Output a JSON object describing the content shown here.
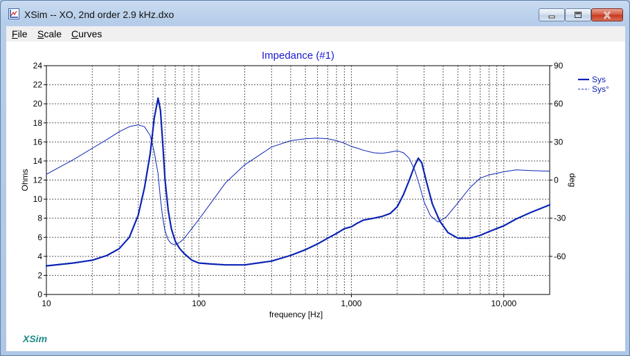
{
  "window": {
    "title": "XSim -- XO, 2nd order 2.9 kHz.dxo",
    "controls": {
      "minimize": "minimize",
      "maximize": "maximize",
      "close": "close"
    }
  },
  "menu": {
    "items": [
      "File",
      "Scale",
      "Curves"
    ]
  },
  "brand": "XSim",
  "colors": {
    "curve": "#0a22b4",
    "title": "#1a1ad4",
    "grid": "#555555"
  },
  "chart_data": {
    "type": "line",
    "title": "Impedance (#1)",
    "xlabel": "frequency [Hz]",
    "ylabel": "Ohms",
    "y2label": "deg",
    "xscale": "log",
    "xlim": [
      10,
      20000
    ],
    "ylim": [
      0,
      24
    ],
    "y2lim": [
      -90,
      90
    ],
    "xticks": [
      10,
      100,
      1000,
      10000
    ],
    "xtick_labels": [
      "10",
      "100",
      "1,000",
      "10,000"
    ],
    "yticks": [
      0,
      2,
      4,
      6,
      8,
      10,
      12,
      14,
      16,
      18,
      20,
      22,
      24
    ],
    "y2ticks": [
      -60,
      -30,
      0,
      30,
      60,
      90
    ],
    "grid": true,
    "legend_position": "top-right",
    "series": [
      {
        "name": "Sys",
        "axis": "left",
        "style": "solid-thick",
        "x": [
          10,
          15,
          20,
          25,
          30,
          35,
          40,
          44,
          48,
          51,
          54,
          56,
          58,
          60,
          63,
          66,
          70,
          75,
          80,
          90,
          100,
          120,
          150,
          200,
          300,
          400,
          500,
          600,
          700,
          800,
          900,
          1000,
          1100,
          1200,
          1400,
          1600,
          1800,
          2000,
          2200,
          2400,
          2600,
          2750,
          2900,
          3100,
          3400,
          3800,
          4300,
          5000,
          6000,
          7000,
          8000,
          10000,
          12000,
          15000,
          20000
        ],
        "values": [
          3.0,
          3.3,
          3.6,
          4.1,
          4.8,
          6.0,
          8.3,
          11.2,
          14.8,
          18.5,
          20.6,
          19.3,
          15.8,
          12.0,
          8.8,
          6.9,
          5.6,
          4.8,
          4.3,
          3.6,
          3.3,
          3.2,
          3.1,
          3.1,
          3.5,
          4.1,
          4.7,
          5.3,
          5.9,
          6.4,
          6.9,
          7.1,
          7.5,
          7.8,
          8.0,
          8.2,
          8.5,
          9.2,
          10.5,
          12.0,
          13.5,
          14.3,
          13.8,
          11.9,
          9.5,
          7.7,
          6.5,
          5.9,
          5.9,
          6.2,
          6.6,
          7.2,
          7.9,
          8.6,
          9.4
        ]
      },
      {
        "name": "Sys°",
        "axis": "right",
        "style": "thin",
        "x": [
          10,
          15,
          20,
          25,
          30,
          35,
          40,
          44,
          48,
          51,
          54,
          56,
          58,
          60,
          63,
          66,
          70,
          75,
          80,
          90,
          100,
          120,
          150,
          200,
          300,
          400,
          500,
          600,
          700,
          800,
          900,
          1000,
          1100,
          1200,
          1400,
          1600,
          1800,
          2000,
          2200,
          2400,
          2600,
          2800,
          3000,
          3300,
          3700,
          4200,
          5000,
          6000,
          7000,
          8000,
          10000,
          12000,
          15000,
          20000
        ],
        "values": [
          4.5,
          16,
          25,
          32,
          38,
          42,
          43.5,
          42,
          35,
          22,
          5,
          -15,
          -30,
          -40,
          -47,
          -50,
          -51,
          -49,
          -46,
          -38,
          -31,
          -18,
          -2,
          12,
          26,
          31,
          32.5,
          33,
          32.5,
          31,
          29,
          26.5,
          25,
          23.5,
          21.5,
          21,
          22,
          23,
          21.5,
          17,
          8,
          -4,
          -17,
          -28,
          -33,
          -29,
          -18,
          -6,
          1.5,
          4,
          6.5,
          8,
          7.5,
          7
        ]
      }
    ]
  }
}
